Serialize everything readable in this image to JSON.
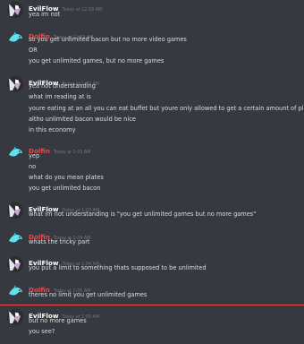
{
  "colors": {
    "evilflow": "#ffffff",
    "dolfin": "#f04747",
    "text": "#dcddde",
    "timestamp": "#72767d",
    "background": "#36393f",
    "new_messages_divider": "#f04747"
  },
  "messages": [
    {
      "author": "EvilFlow",
      "time": "Today at 12:58 AM",
      "lines": [
        "yea im not"
      ]
    },
    {
      "author": "Dolfin",
      "time": "Today at 12:59 AM",
      "lines": [
        "so you get unlimited bacon but no more video games",
        "OR",
        "you get unlimited games, but no more games"
      ]
    },
    {
      "author": "EvilFlow",
      "time": "Today at 1:00 AM",
      "lines": [
        "yea not understanding",
        "what im reading at is",
        "youre eating at an all you can eat buffet but youre only allowed to get a certain amount of plates",
        "altho unlimited bacon would be nice",
        "in this economy"
      ]
    },
    {
      "author": "Dolfin",
      "time": "Today at 1:03 AM",
      "lines": [
        "yep",
        "no",
        "what do you mean plates",
        "you get unlimited bacon"
      ]
    },
    {
      "author": "EvilFlow",
      "time": "Today at 1:03 AM",
      "lines": [
        "what im not understanding is \"you get unlimited games but no more games\""
      ]
    },
    {
      "author": "Dolfin",
      "time": "Today at 1:04 AM",
      "lines": [
        "whats the tricky part"
      ]
    },
    {
      "author": "EvilFlow",
      "time": "Today at 1:04 AM",
      "lines": [
        "you put a limit to something thats supposed to be unlimited"
      ]
    },
    {
      "author": "Dolfin",
      "time": "Today at 1:05 AM",
      "lines": [
        "theres no limit you get unlimited games"
      ]
    },
    {
      "author": "EvilFlow",
      "time": "Today at 1:05 AM",
      "lines": [
        "but no more games",
        "you see?"
      ]
    }
  ]
}
